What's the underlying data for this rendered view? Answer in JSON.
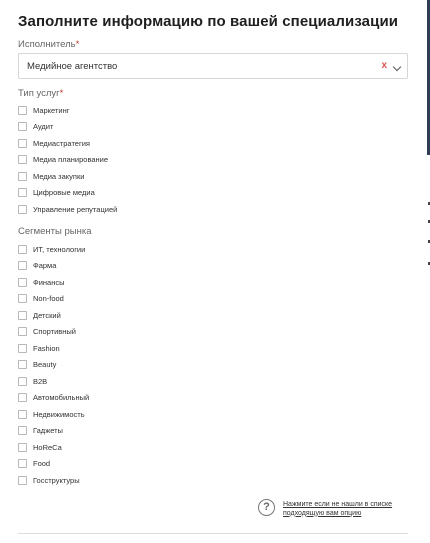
{
  "form": {
    "title": "Заполните информацию по вашей специализации",
    "performer": {
      "label": "Исполнитель",
      "required_mark": "*",
      "selected_value": "Медийное агентство",
      "clear_symbol": "x"
    },
    "service_types": {
      "label": "Тип услуг",
      "required_mark": "*",
      "options": [
        "Маркетинг",
        "Аудит",
        "Медиастратегия",
        "Медиа планирование",
        "Медиа закупки",
        "Цифровые медиа",
        "Управление репутацией"
      ]
    },
    "market_segments": {
      "label": "Сегменты рынка",
      "options": [
        "ИТ, технологии",
        "Фарма",
        "Финансы",
        "Non-food",
        "Детский",
        "Спортивный",
        "Fashion",
        "Beauty",
        "B2B",
        "Автомобильный",
        "Недвижимость",
        "Гаджеты",
        "HoReCa",
        "Food",
        "Госструктуры"
      ]
    },
    "help": {
      "icon_symbol": "?",
      "link_text": "Нажмите если не нашли в списке подходящую вам опцию"
    }
  },
  "colors": {
    "required": "#c0392b",
    "clear": "#d9534f",
    "side_strip": "#2f3e56"
  }
}
